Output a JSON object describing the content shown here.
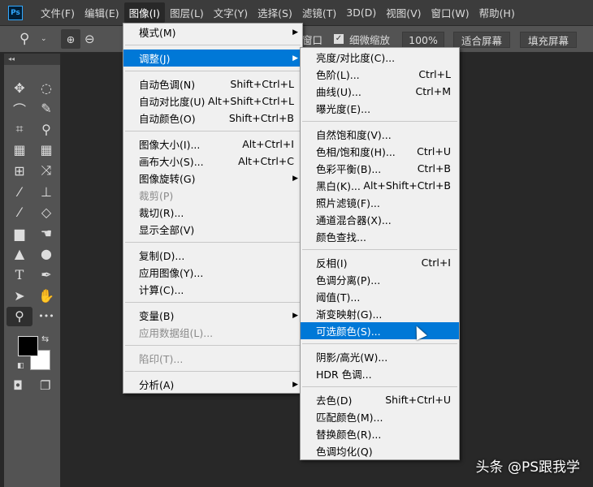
{
  "app": {
    "logo": "Ps"
  },
  "menubar": [
    "文件(F)",
    "编辑(E)",
    "图像(I)",
    "图层(L)",
    "文字(Y)",
    "选择(S)",
    "滤镜(T)",
    "3D(D)",
    "视图(V)",
    "窗口(W)",
    "帮助(H)"
  ],
  "menubar_active": "图像(I)",
  "options": {
    "window_label": "窗口",
    "scrubby_zoom_label": "细微缩放",
    "scrubby_zoom_checked": true,
    "zoom_value": "100%",
    "fit_screen": "适合屏幕",
    "fill_screen": "填充屏幕"
  },
  "image_menu": [
    {
      "label": "模式(M)",
      "submenu": true
    },
    {
      "sep": true
    },
    {
      "label": "调整(J)",
      "submenu": true,
      "highlight": true
    },
    {
      "sep": true
    },
    {
      "label": "自动色调(N)",
      "shortcut": "Shift+Ctrl+L"
    },
    {
      "label": "自动对比度(U)",
      "shortcut": "Alt+Shift+Ctrl+L"
    },
    {
      "label": "自动颜色(O)",
      "shortcut": "Shift+Ctrl+B"
    },
    {
      "sep": true
    },
    {
      "label": "图像大小(I)...",
      "shortcut": "Alt+Ctrl+I"
    },
    {
      "label": "画布大小(S)...",
      "shortcut": "Alt+Ctrl+C"
    },
    {
      "label": "图像旋转(G)",
      "submenu": true
    },
    {
      "label": "裁剪(P)",
      "disabled": true
    },
    {
      "label": "裁切(R)..."
    },
    {
      "label": "显示全部(V)"
    },
    {
      "sep": true
    },
    {
      "label": "复制(D)..."
    },
    {
      "label": "应用图像(Y)..."
    },
    {
      "label": "计算(C)..."
    },
    {
      "sep": true
    },
    {
      "label": "变量(B)",
      "submenu": true
    },
    {
      "label": "应用数据组(L)...",
      "disabled": true
    },
    {
      "sep": true
    },
    {
      "label": "陷印(T)...",
      "disabled": true
    },
    {
      "sep": true
    },
    {
      "label": "分析(A)",
      "submenu": true
    }
  ],
  "adjust_menu": [
    {
      "label": "亮度/对比度(C)..."
    },
    {
      "label": "色阶(L)...",
      "shortcut": "Ctrl+L"
    },
    {
      "label": "曲线(U)...",
      "shortcut": "Ctrl+M"
    },
    {
      "label": "曝光度(E)..."
    },
    {
      "sep": true
    },
    {
      "label": "自然饱和度(V)..."
    },
    {
      "label": "色相/饱和度(H)...",
      "shortcut": "Ctrl+U"
    },
    {
      "label": "色彩平衡(B)...",
      "shortcut": "Ctrl+B"
    },
    {
      "label": "黑白(K)...",
      "shortcut": "Alt+Shift+Ctrl+B"
    },
    {
      "label": "照片滤镜(F)..."
    },
    {
      "label": "通道混合器(X)..."
    },
    {
      "label": "颜色查找..."
    },
    {
      "sep": true
    },
    {
      "label": "反相(I)",
      "shortcut": "Ctrl+I"
    },
    {
      "label": "色调分离(P)..."
    },
    {
      "label": "阈值(T)..."
    },
    {
      "label": "渐变映射(G)..."
    },
    {
      "label": "可选颜色(S)...",
      "highlight": true
    },
    {
      "sep": true
    },
    {
      "label": "阴影/高光(W)..."
    },
    {
      "label": "HDR 色调..."
    },
    {
      "sep": true
    },
    {
      "label": "去色(D)",
      "shortcut": "Shift+Ctrl+U"
    },
    {
      "label": "匹配颜色(M)..."
    },
    {
      "label": "替换颜色(R)..."
    },
    {
      "label": "色调均化(Q)"
    }
  ],
  "tools": [
    {
      "name": "move-tool",
      "glyph": "✥"
    },
    {
      "name": "marquee-tool",
      "glyph": "◌"
    },
    {
      "name": "lasso-tool",
      "glyph": "⌒"
    },
    {
      "name": "quick-select-tool",
      "glyph": "✎"
    },
    {
      "name": "crop-tool",
      "glyph": "⌗"
    },
    {
      "name": "eyedropper-tool",
      "glyph": "⚲"
    },
    {
      "name": "spot-healing-tool",
      "glyph": "▦"
    },
    {
      "name": "healing-brush-tool",
      "glyph": "▦"
    },
    {
      "name": "content-aware-tool",
      "glyph": "⊞"
    },
    {
      "name": "puppet-warp-tool",
      "glyph": "⤨"
    },
    {
      "name": "brush-tool",
      "glyph": "⁄"
    },
    {
      "name": "clone-stamp-tool",
      "glyph": "⊥"
    },
    {
      "name": "history-brush-tool",
      "glyph": "⁄"
    },
    {
      "name": "eraser-tool",
      "glyph": "◇"
    },
    {
      "name": "gradient-tool",
      "glyph": "▆"
    },
    {
      "name": "smudge-tool",
      "glyph": "☚"
    },
    {
      "name": "sharpen-tool",
      "glyph": "▲"
    },
    {
      "name": "dodge-tool",
      "glyph": "●"
    },
    {
      "name": "type-tool",
      "glyph": "T"
    },
    {
      "name": "pen-tool",
      "glyph": "✒"
    },
    {
      "name": "path-select-tool",
      "glyph": "➤"
    },
    {
      "name": "hand-tool",
      "glyph": "✋"
    },
    {
      "name": "zoom-tool",
      "glyph": "⚲",
      "selected": true
    },
    {
      "name": "more-tools",
      "glyph": "•••"
    }
  ],
  "colors": {
    "foreground": "#000000",
    "background": "#ffffff",
    "highlight": "#0078d7"
  },
  "watermark": "头条 @PS跟我学"
}
